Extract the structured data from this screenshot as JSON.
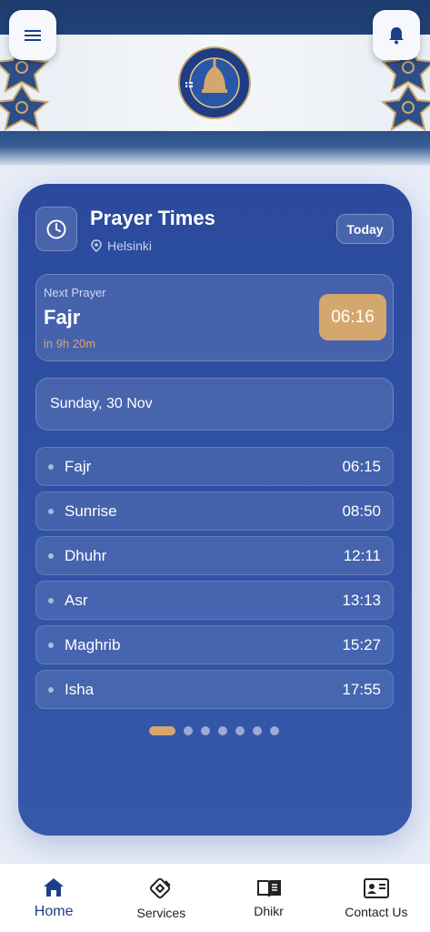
{
  "header": {
    "emblem": "mosque-emblem-logo",
    "menu_icon": "hamburger-menu-icon",
    "notification_icon": "bell-icon"
  },
  "card": {
    "title": "Prayer Times",
    "location": "Helsinki",
    "today_label": "Today",
    "next_prayer": {
      "label": "Next Prayer",
      "name": "Fajr",
      "eta": "in 9h 20m",
      "time": "06:16"
    },
    "date": "Sunday, 30 Nov",
    "prayers": [
      {
        "name": "Fajr",
        "time": "06:15"
      },
      {
        "name": "Sunrise",
        "time": "08:50"
      },
      {
        "name": "Dhuhr",
        "time": "12:11"
      },
      {
        "name": "Asr",
        "time": "13:13"
      },
      {
        "name": "Maghrib",
        "time": "15:27"
      },
      {
        "name": "Isha",
        "time": "17:55"
      }
    ],
    "pager": {
      "count": 7,
      "active": 0
    }
  },
  "nav": {
    "items": [
      {
        "label": "Home",
        "icon": "home-icon",
        "active": true
      },
      {
        "label": "Services",
        "icon": "handshake-icon",
        "active": false
      },
      {
        "label": "Dhikr",
        "icon": "book-icon",
        "active": false
      },
      {
        "label": "Contact Us",
        "icon": "contact-card-icon",
        "active": false
      }
    ]
  },
  "colors": {
    "primary": "#2b4a9e",
    "accent_gold": "#d4a76e",
    "nav_active": "#1d3f8a"
  }
}
